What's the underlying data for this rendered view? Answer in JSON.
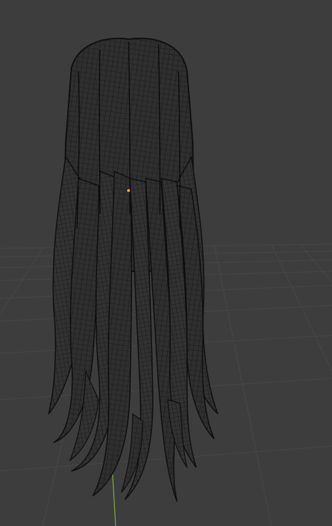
{
  "viewport": {
    "background_color": "#3d3d3d",
    "grid_color": "#4a4a4a",
    "axis_y_color": "#7fae3c",
    "wire_color": "#111111",
    "mesh_fill_color": "#2e2e2e",
    "origin_color": "#f29d12"
  },
  "object": {
    "icon": "hair-mesh-wireframe",
    "origin_icon": "object-origin-dot"
  }
}
